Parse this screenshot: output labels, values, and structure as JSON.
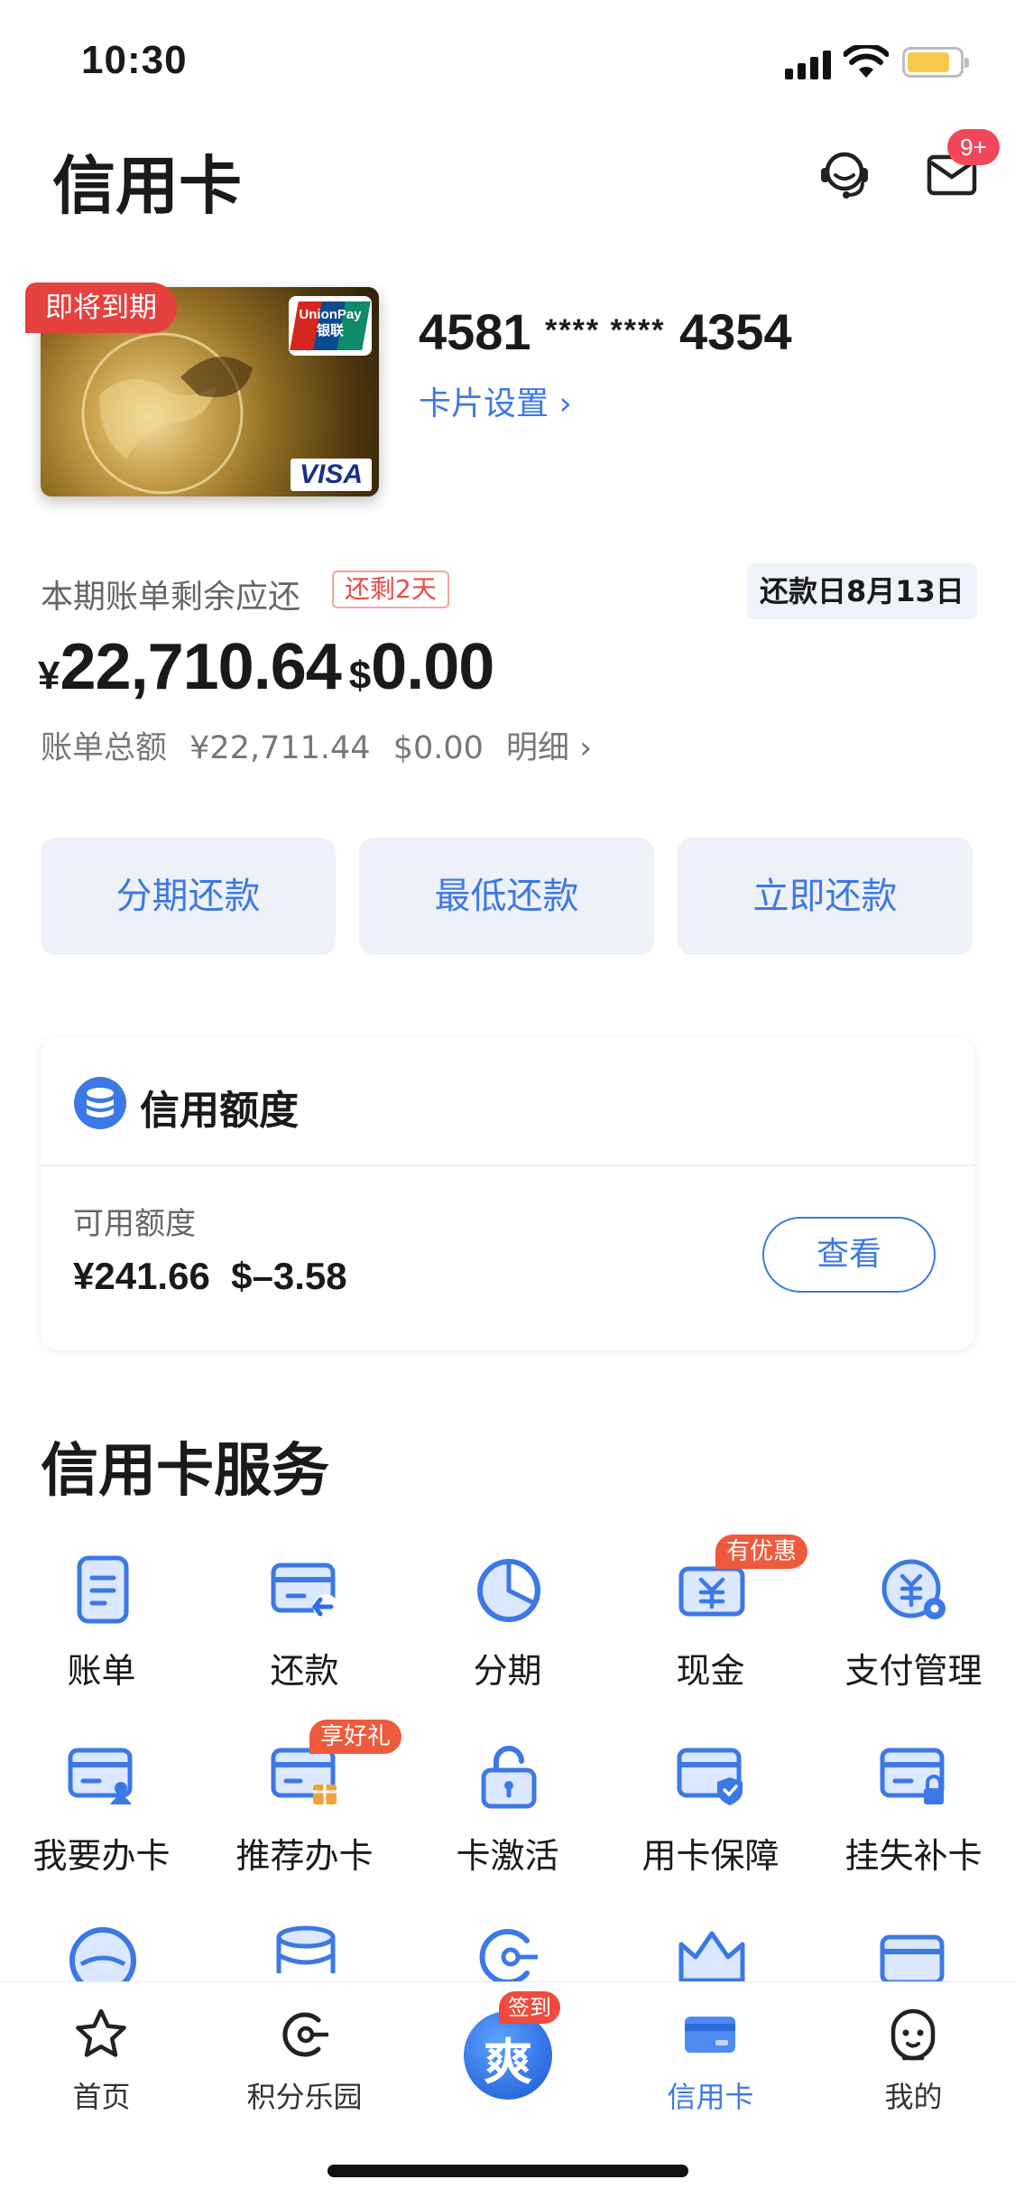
{
  "status_bar": {
    "time": "10:30"
  },
  "header": {
    "title": "信用卡",
    "mail_badge": "9+"
  },
  "card": {
    "expiry_tag": "即将到期",
    "number_prefix": "4581",
    "number_mask": "**** ****",
    "number_suffix": "4354",
    "settings_link": "卡片设置 ›",
    "unionpay_text": "UnionPay\n银联",
    "visa_text": "VISA"
  },
  "bill": {
    "label": "本期账单剩余应还",
    "due_badge": "还剩2天",
    "due_date": "还款日8月13日",
    "rmb_symbol": "¥",
    "rmb_amount": "22,710.64",
    "usd_symbol": "$",
    "usd_amount": "0.00",
    "total_label": "账单总额",
    "total_rmb": "¥22,711.44",
    "total_usd": "$0.00",
    "detail_link": "明细 ›"
  },
  "actions": [
    {
      "label": "分期还款"
    },
    {
      "label": "最低还款"
    },
    {
      "label": "立即还款"
    }
  ],
  "credit_limit": {
    "title": "信用额度",
    "available_label": "可用额度",
    "available_rmb": "¥241.66",
    "available_usd": "$–3.58",
    "view_button": "查看"
  },
  "services": {
    "title": "信用卡服务",
    "items": [
      {
        "label": "账单",
        "icon": "bill-icon"
      },
      {
        "label": "还款",
        "icon": "repay-icon"
      },
      {
        "label": "分期",
        "icon": "installment-icon"
      },
      {
        "label": "现金",
        "icon": "cash-icon",
        "tag": "有优惠"
      },
      {
        "label": "支付管理",
        "icon": "payment-manage-icon"
      },
      {
        "label": "我要办卡",
        "icon": "apply-card-icon"
      },
      {
        "label": "推荐办卡",
        "icon": "recommend-card-icon",
        "tag": "享好礼"
      },
      {
        "label": "卡激活",
        "icon": "card-activate-icon"
      },
      {
        "label": "用卡保障",
        "icon": "card-protect-icon"
      },
      {
        "label": "挂失补卡",
        "icon": "report-loss-icon"
      }
    ]
  },
  "bottom_nav": {
    "items": [
      {
        "label": "首页",
        "icon": "star-icon"
      },
      {
        "label": "积分乐园",
        "icon": "points-icon"
      },
      {
        "label": "信用卡",
        "icon": "credit-card-icon",
        "active": true
      },
      {
        "label": "我的",
        "icon": "profile-icon"
      }
    ],
    "center_badge": "签到",
    "center_glyph": "爽"
  },
  "colors": {
    "accent": "#3c78e6",
    "alert": "#e5413f",
    "button_bg": "#eef1f8"
  }
}
